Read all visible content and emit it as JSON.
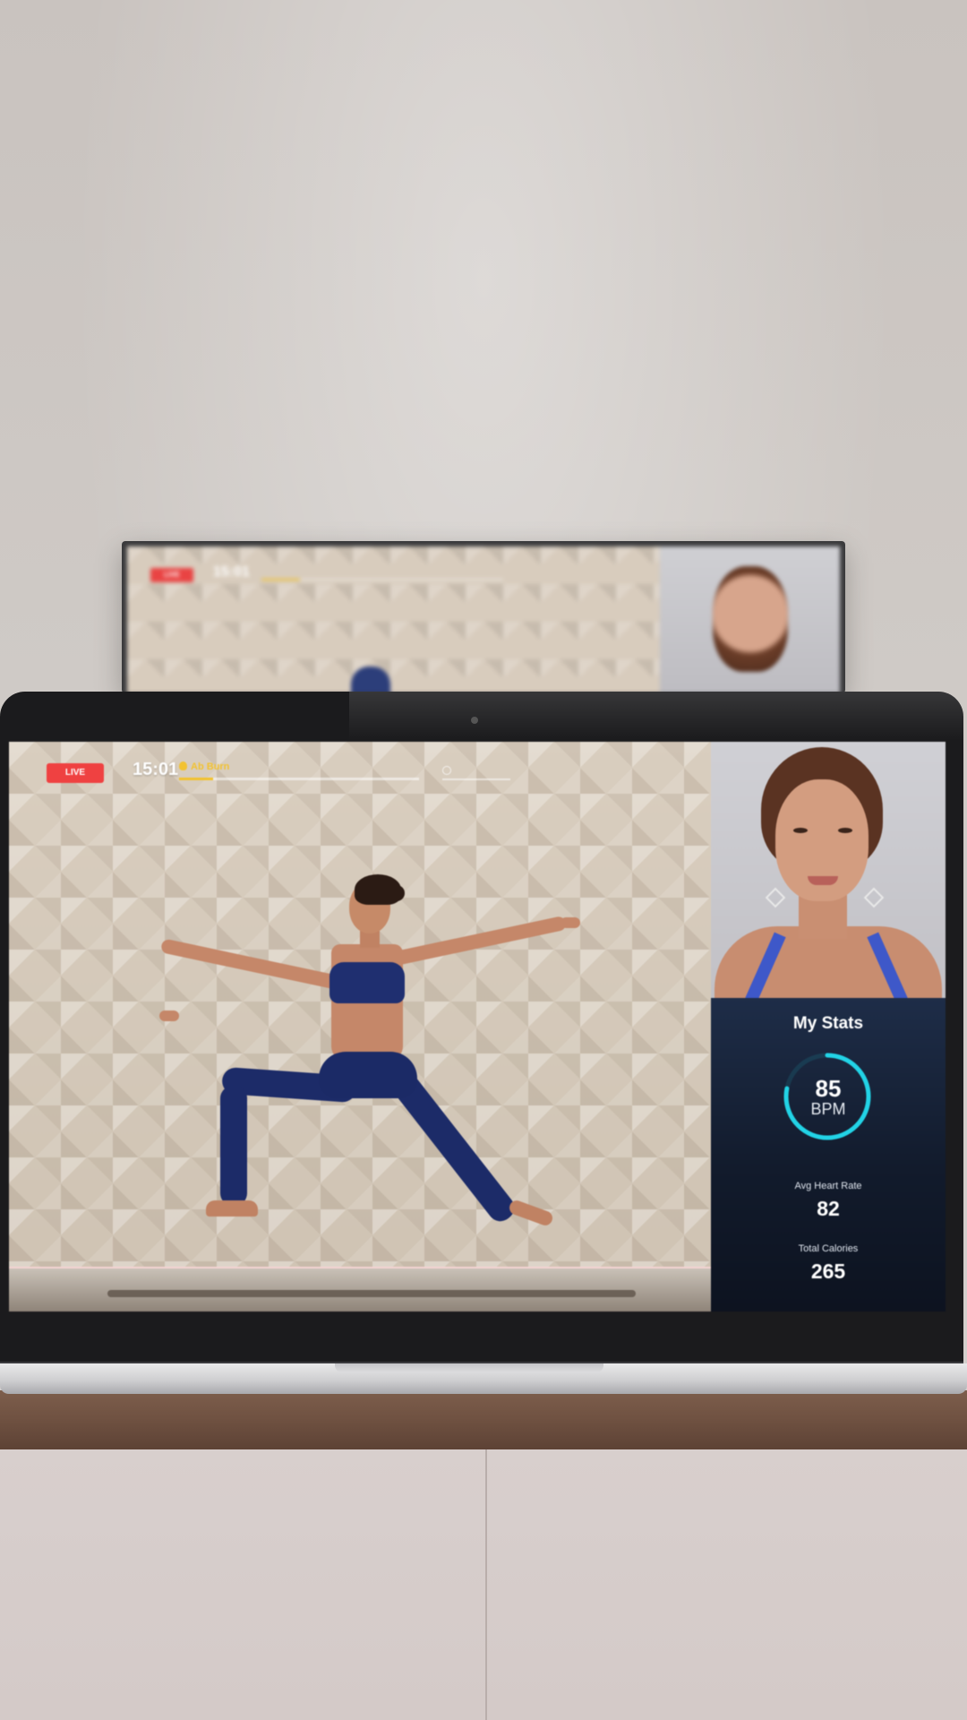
{
  "tv": {
    "live_label": "LIVE",
    "time": "15:01"
  },
  "screen": {
    "live_label": "LIVE",
    "time": "15:01",
    "segment_label": "Ab Burn",
    "segment_progress": 0.14,
    "accent_color": "#f2c230",
    "live_color": "#ef4141"
  },
  "stats": {
    "title": "My Stats",
    "bpm_value": "85",
    "bpm_unit": "BPM",
    "ring_fraction": 0.78,
    "ring_color": "#22d3e6",
    "avg_label": "Avg Heart Rate",
    "avg_value": "82",
    "cal_label": "Total Calories",
    "cal_value": "265"
  }
}
